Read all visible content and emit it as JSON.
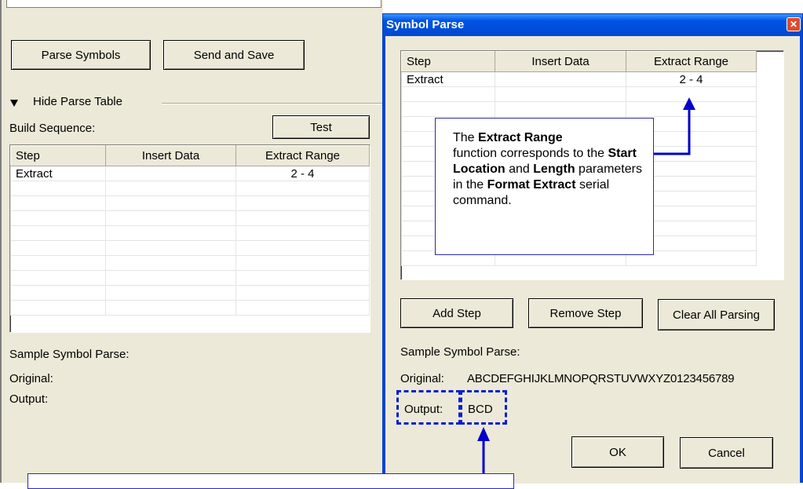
{
  "left_panel": {
    "parse_symbols_label": "Parse Symbols",
    "send_and_save_label": "Send and Save",
    "hide_table_label": "Hide Parse Table",
    "build_sequence_label": "Build Sequence:",
    "test_label": "Test",
    "table_headers": [
      "Step",
      "Insert Data",
      "Extract Range"
    ],
    "rows": [
      {
        "step": "Extract",
        "insert": "",
        "range": "2 - 4"
      }
    ],
    "sample_label": "Sample Symbol Parse:",
    "original_label": "Original:",
    "output_label": "Output:"
  },
  "dialog": {
    "title": "Symbol Parse",
    "close_glyph": "✕",
    "table_headers": [
      "Step",
      "Insert Data",
      "Extract Range"
    ],
    "rows": [
      {
        "step": "Extract",
        "insert": "",
        "range": "2 - 4"
      }
    ],
    "add_step_label": "Add Step",
    "remove_step_label": "Remove Step",
    "clear_all_label": "Clear All Parsing",
    "sample_label": "Sample Symbol Parse:",
    "original_label": "Original:",
    "original_value": "ABCDEFGHIJKLMNOPQRSTUVWXYZ0123456789",
    "output_label": "Output:",
    "output_value": "BCD",
    "ok_label": "OK",
    "cancel_label": "Cancel"
  },
  "callout": {
    "t1": "The ",
    "b1": "Extract Range",
    "t2": "function corresponds to the ",
    "b2": "Start Location",
    "t3": " and ",
    "b3": "Length",
    "t4": " parameters in the ",
    "b4": "Format Extract",
    "t5": " serial command."
  },
  "colors": {
    "panel_bg": "#ece9d8",
    "titlebar_start": "#0054e3",
    "titlebar_end": "#3d95ff",
    "callout_border": "#2a2ab0",
    "arrow": "#0000cc",
    "close_bg": "#e04a2c"
  }
}
